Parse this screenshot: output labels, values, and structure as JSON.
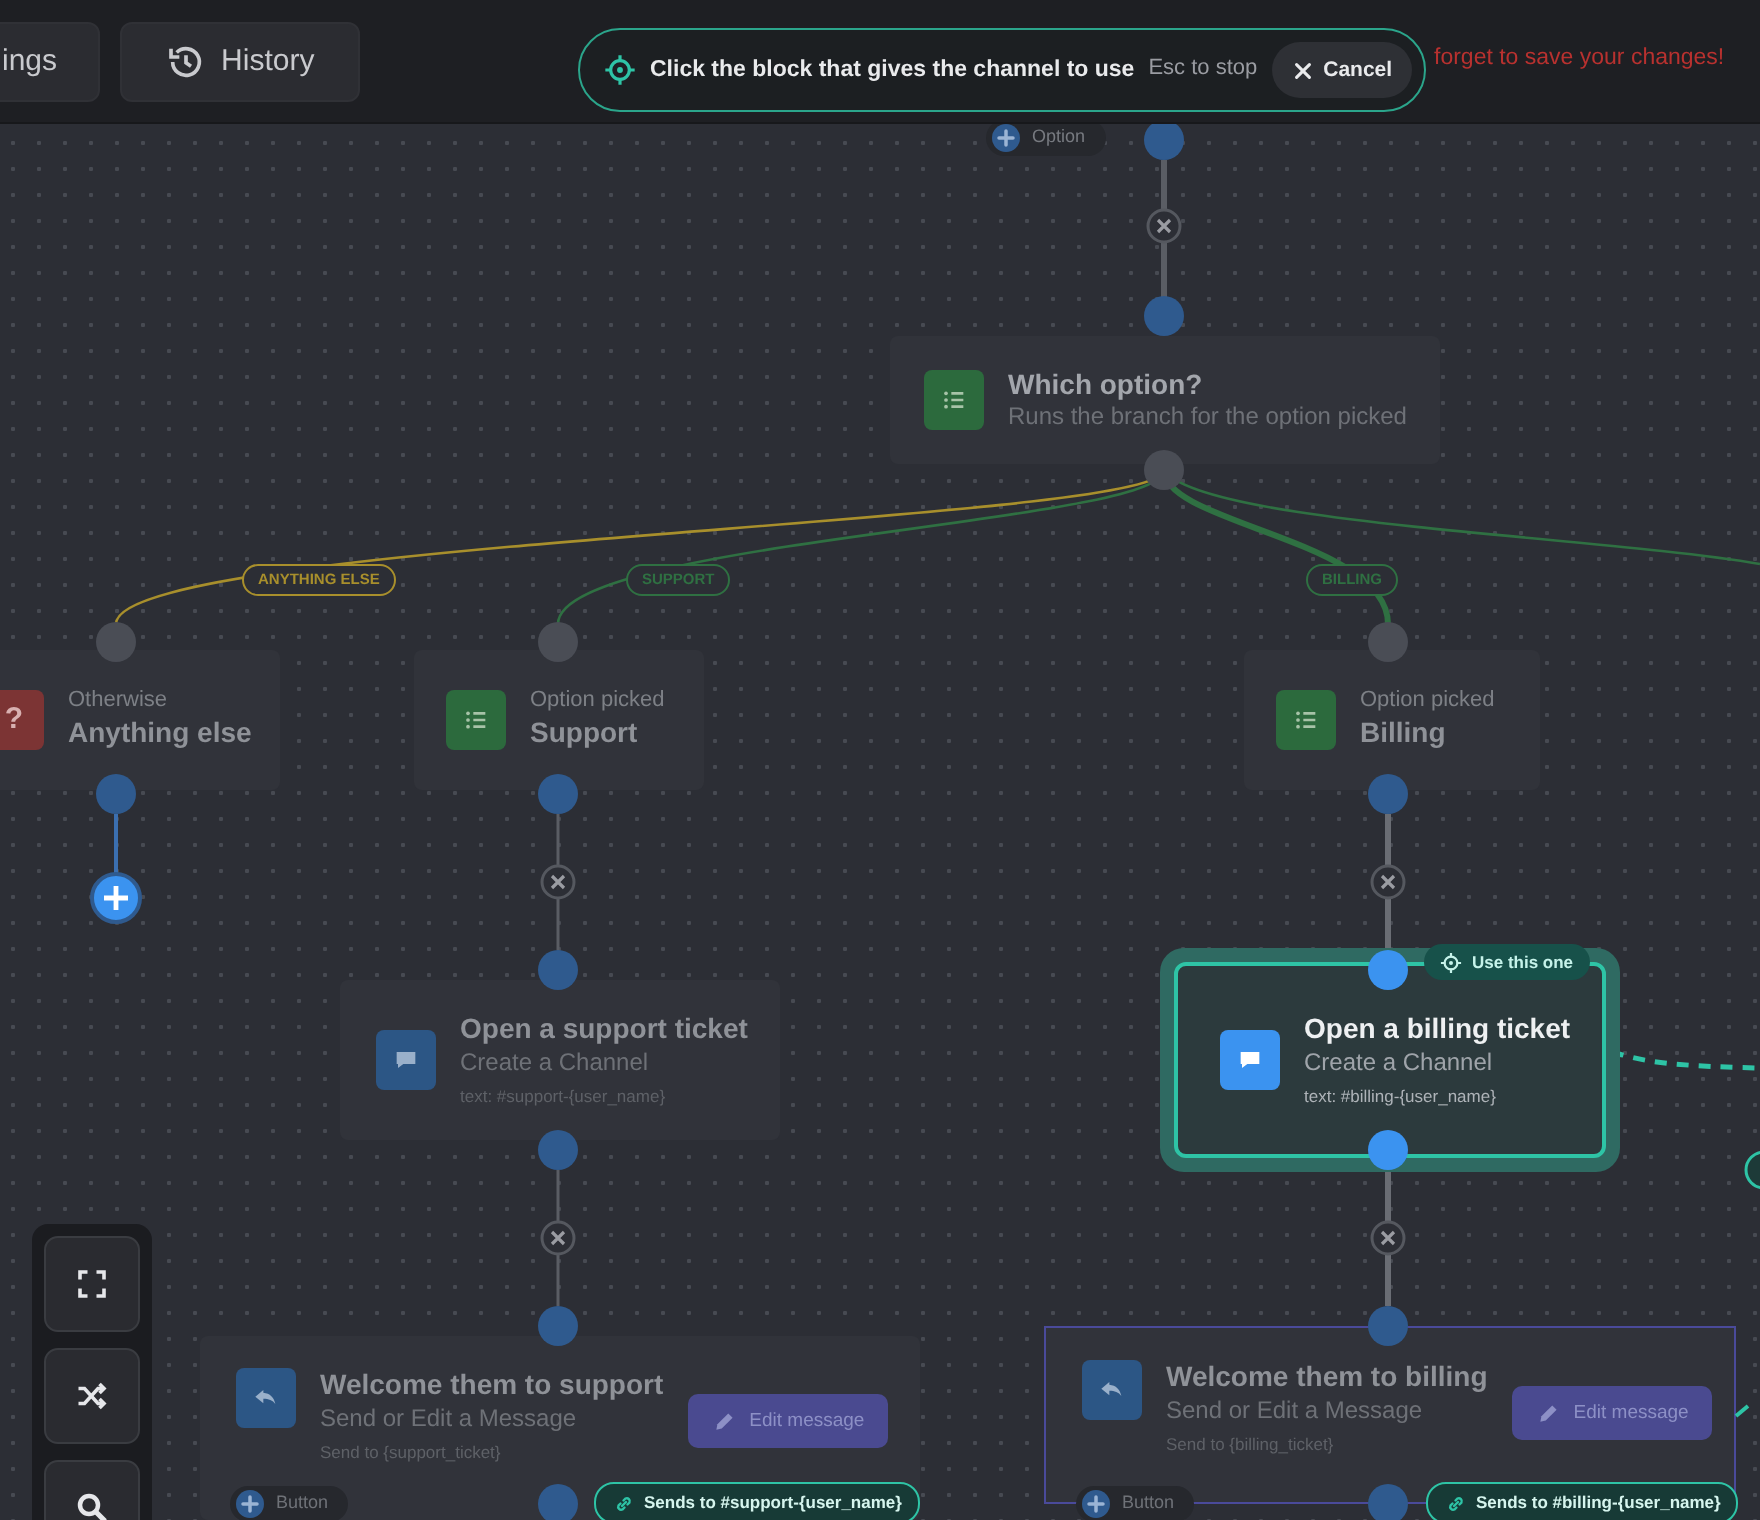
{
  "top_bar": {
    "buttons": [
      {
        "label": "ings"
      },
      {
        "label": "History"
      }
    ],
    "notice": "forget to save your changes!"
  },
  "pick_banner": {
    "message": "Click the block that gives the channel to use",
    "hint": "Esc to stop",
    "cancel": "Cancel"
  },
  "canvas": {
    "option_chip": "Option",
    "edges": [
      {
        "label": "ANYTHING ELSE",
        "color": "#a88f2c"
      },
      {
        "label": "SUPPORT",
        "color": "#2f7042"
      },
      {
        "label": "BILLING",
        "color": "#2f7042"
      }
    ],
    "nodes": [
      {
        "kind": "question",
        "title": "Which option?",
        "subtitle": "Runs the branch for the option picked",
        "selected": false
      },
      {
        "kind": "fallback",
        "symbol": "?",
        "caption": "Otherwise",
        "title": "Anything else",
        "selected": false
      },
      {
        "kind": "branch",
        "caption": "Option picked",
        "title": "Support",
        "selected": false
      },
      {
        "kind": "branch",
        "caption": "Option picked",
        "title": "Billing",
        "selected": false
      },
      {
        "kind": "channel",
        "title": "Open a support ticket",
        "subtitle": "Create a Channel",
        "detail": "text: #support-{user_name}",
        "selected": false
      },
      {
        "kind": "channel",
        "title": "Open a billing ticket",
        "subtitle": "Create a Channel",
        "detail": "text: #billing-{user_name}",
        "selected": true,
        "badge": "Use this one"
      },
      {
        "kind": "message",
        "title": "Welcome them to support",
        "subtitle": "Send or Edit a Message",
        "detail": "Send to {support_ticket}",
        "action": "Edit message",
        "button_chip": "Button",
        "link_chip": "Sends to #support-{user_name}",
        "selected": false,
        "outlined": false
      },
      {
        "kind": "message",
        "title": "Welcome them to billing",
        "subtitle": "Send or Edit a Message",
        "detail": "Send to {billing_ticket}",
        "action": "Edit message",
        "button_chip": "Button",
        "link_chip": "Sends to #billing-{user_name}",
        "selected": false,
        "outlined": true
      }
    ]
  }
}
